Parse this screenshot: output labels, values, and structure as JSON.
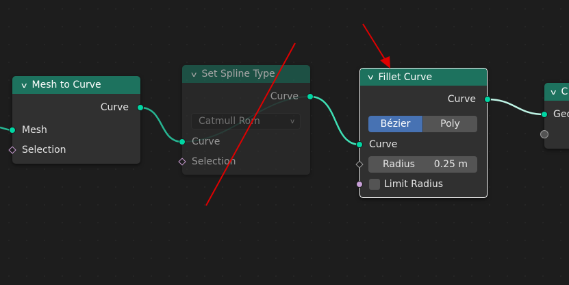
{
  "colors": {
    "background": "#1d1d1d",
    "node_body": "#303030",
    "header_green": "#1d725e",
    "geometry_socket": "#00d6a3",
    "selection_socket": "#cc9ed6",
    "selected_outline": "#ffffff",
    "enum_active": "#4772b3",
    "annotation_red": "#e00000"
  },
  "icons": {
    "collapse": "chevron-down-icon",
    "dropdown": "chevron-down-icon",
    "collapse_glyph": "v"
  },
  "mesh_to_curve": {
    "title": "Mesh to Curve",
    "output_curve": "Curve",
    "input_mesh": "Mesh",
    "input_selection": "Selection"
  },
  "set_spline_type": {
    "title": "Set Spline Type",
    "output_curve": "Curve",
    "spline_type": "Catmull Rom",
    "input_curve": "Curve",
    "input_selection": "Selection",
    "muted": true
  },
  "fillet_curve": {
    "title": "Fillet Curve",
    "output_curve": "Curve",
    "mode_options": [
      "Bézier",
      "Poly"
    ],
    "mode_selected": "Bézier",
    "input_curve": "Curve",
    "radius_label": "Radius",
    "radius_value": "0.25 m",
    "limit_radius_label": "Limit Radius",
    "limit_radius_checked": false
  },
  "right_node": {
    "title": "C",
    "input_geometry": "Geo"
  }
}
